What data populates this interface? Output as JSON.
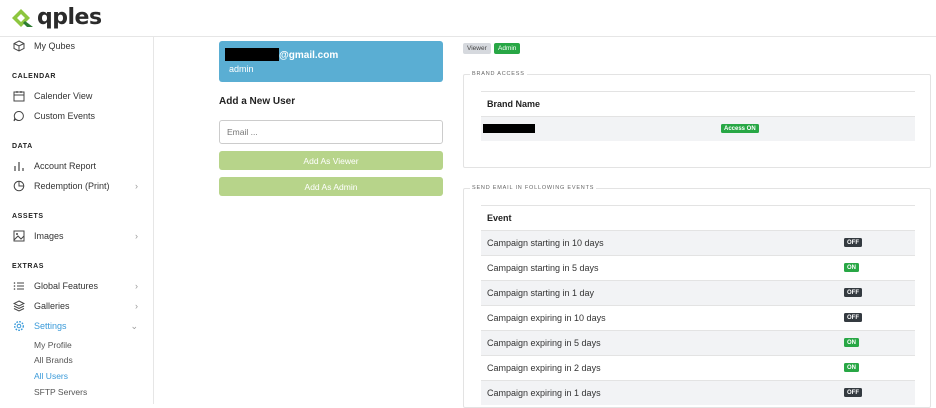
{
  "brand": {
    "name": "qples"
  },
  "sidebar": {
    "top_item": {
      "label": "My Qubes",
      "icon": "cube-icon"
    },
    "sections": {
      "calendar": "CALENDAR",
      "data": "DATA",
      "assets": "ASSETS",
      "extras": "EXTRAS"
    },
    "items": {
      "calendar_view": "Calender View",
      "custom_events": "Custom Events",
      "account_report": "Account Report",
      "redemption": "Redemption (Print)",
      "images": "Images",
      "global_features": "Global Features",
      "galleries": "Galleries",
      "settings": "Settings"
    },
    "sub_items": {
      "my_profile": "My Profile",
      "all_brands": "All Brands",
      "all_users": "All Users",
      "sftp_servers": "SFTP Servers"
    },
    "active_color": "#3a9ad9"
  },
  "user_card": {
    "email_suffix": "@gmail.com",
    "role": "admin",
    "bg_color": "#5aaed3"
  },
  "add_user": {
    "title": "Add a New User",
    "email_placeholder": "Email ...",
    "add_viewer_label": "Add As Viewer",
    "add_admin_label": "Add As Admin",
    "button_color": "#b7d48a"
  },
  "role_tags": {
    "viewer": "Viewer",
    "admin": "Admin"
  },
  "brand_access": {
    "legend": "BRAND ACCESS",
    "header": "Brand Name",
    "rows": [
      {
        "status": "Access ON"
      }
    ]
  },
  "email_events": {
    "legend": "SEND EMAIL IN FOLLOWING EVENTS",
    "header": "Event",
    "rows": [
      {
        "label": "Campaign starting in 10 days",
        "status": "OFF"
      },
      {
        "label": "Campaign starting in 5 days",
        "status": "ON"
      },
      {
        "label": "Campaign starting in 1 day",
        "status": "OFF"
      },
      {
        "label": "Campaign expiring in 10 days",
        "status": "OFF"
      },
      {
        "label": "Campaign expiring in 5 days",
        "status": "ON"
      },
      {
        "label": "Campaign expiring in 2 days",
        "status": "ON"
      },
      {
        "label": "Campaign expiring in 1 days",
        "status": "OFF"
      }
    ]
  },
  "colors": {
    "on": "#28a745",
    "off": "#343a40"
  }
}
